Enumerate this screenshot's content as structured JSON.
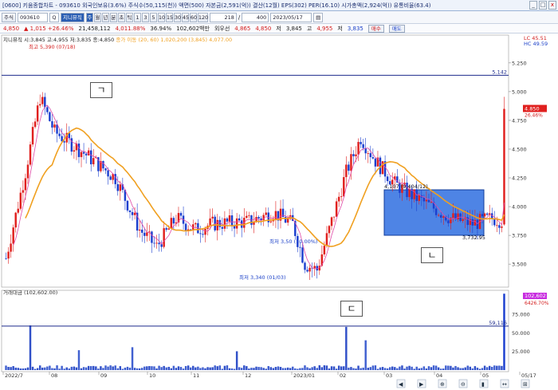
{
  "titlebar": {
    "text": "[0600] 키움종합차트 - 093610 외국인보유(3.6%) 주식수(50,115(천)) 액면(500) 자본금(2,591(억)) 결산(12월) EPS(302) PER(16.10) 시가총액(2,924(억)) 유통비율(63.4)",
    "min": "_",
    "max": "□",
    "close": "x"
  },
  "toolbar": {
    "period_label": "주식",
    "code": "093610",
    "search_icon": "Q",
    "name": "지니뮤직",
    "periods": [
      "주",
      "월",
      "년",
      "분",
      "초",
      "틱",
      "1",
      "3",
      "5",
      "10",
      "15",
      "30",
      "45",
      "60",
      "120"
    ],
    "count": "218",
    "total": "400",
    "date": "2023/05/17",
    "menu_icon": "▤"
  },
  "quote": {
    "price": "4,850",
    "change": "▲ 1,015 +26.46%",
    "volume": "21,458,112",
    "amount": "4,011.88%",
    "ratio": "36.94%",
    "trade_value": "102,602백만",
    "unit": "외우선",
    "ask": "4,865",
    "bid": "4,850",
    "low_label": "저",
    "low": "3,845",
    "high_label": "고",
    "high": "4,955",
    "prev_label": "저",
    "prev": "3,835",
    "buy_btn": "매수",
    "sell_btn": "매도"
  },
  "legend": {
    "name": "지니뮤직",
    "ohlc": "시:3,845 고:4,955 저:3,835 종:4,850",
    "ma": "종가 이동 (20, 60) 1,020,200 (3,845) 4,077.00"
  },
  "chart_data": {
    "type": "candlestick",
    "yaxis_ticks": [
      "5.250",
      "5.000",
      "4.750",
      "4.500",
      "4.250",
      "4.000",
      "3.750",
      "3.500"
    ],
    "x_ticks": [
      "2022/7",
      "08",
      "09",
      "10",
      "11",
      "12",
      "2023/01",
      "02",
      "03",
      "04",
      "05",
      "05/17"
    ],
    "ref_line": 5142,
    "ref_label": "5.142",
    "last_price_label": "4.850",
    "last_change_label": "26.46%",
    "top_right": "LC 45.51",
    "top_right2": "HC 49.59",
    "high_annot": "최고 5,390 (07/18)",
    "low_annot": "최저 3,340 (01/03)",
    "mid_annot": "최저 3,50 (10.00%)",
    "box_high": "4,107 (9,404/12)",
    "box_low": "3,732.95",
    "ylim": [
      3300,
      5450
    ]
  },
  "volume": {
    "legend": "거래대금 (102,602.00)",
    "y_ticks": [
      "75.000",
      "50.000",
      "25.000"
    ],
    "ref_label": "59,116",
    "last_label": "102,602",
    "last_pct": "6426.70%"
  },
  "markers": {
    "m1": "ㄱ",
    "m2": "ㄴ",
    "m3": "ㄷ"
  },
  "footer": {
    "nav_icons": [
      "◀",
      "▶",
      "⊕",
      "⊖",
      "▮",
      "↔",
      "⊞"
    ]
  }
}
